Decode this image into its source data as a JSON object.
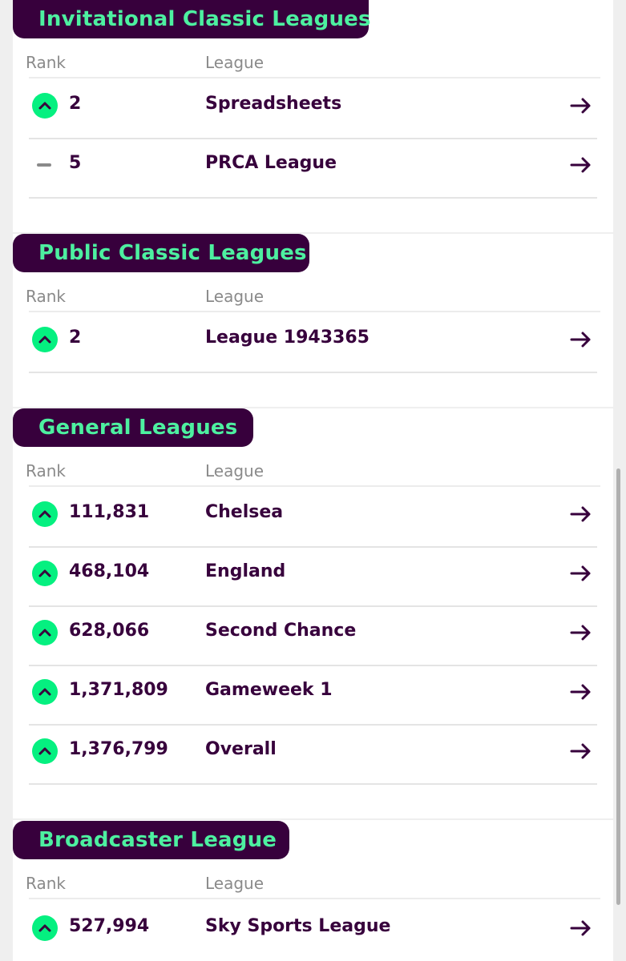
{
  "columns": {
    "rank": "Rank",
    "league": "League"
  },
  "sections": [
    {
      "title": "Invitational Classic Leagues",
      "rows": [
        {
          "movement": "up",
          "rank": "2",
          "league": "Spreadsheets"
        },
        {
          "movement": "same",
          "rank": "5",
          "league": "PRCA League"
        }
      ]
    },
    {
      "title": "Public Classic Leagues",
      "rows": [
        {
          "movement": "up",
          "rank": "2",
          "league": "League 1943365"
        }
      ]
    },
    {
      "title": "General Leagues",
      "rows": [
        {
          "movement": "up",
          "rank": "111,831",
          "league": "Chelsea"
        },
        {
          "movement": "up",
          "rank": "468,104",
          "league": "England"
        },
        {
          "movement": "up",
          "rank": "628,066",
          "league": "Second Chance"
        },
        {
          "movement": "up",
          "rank": "1,371,809",
          "league": "Gameweek 1"
        },
        {
          "movement": "up",
          "rank": "1,376,799",
          "league": "Overall"
        }
      ]
    },
    {
      "title": "Broadcaster League",
      "rows": [
        {
          "movement": "up",
          "rank": "527,994",
          "league": "Sky Sports League"
        }
      ]
    }
  ],
  "icons": {
    "movement_up": "chevron-up-icon",
    "movement_same": "dash-icon",
    "row_link": "arrow-right-icon"
  },
  "colors": {
    "header_bg": "#37003c",
    "header_text": "#4df0a0",
    "movement_up": "#05f080",
    "text_primary": "#37003c",
    "text_muted": "#8a8a8a"
  }
}
